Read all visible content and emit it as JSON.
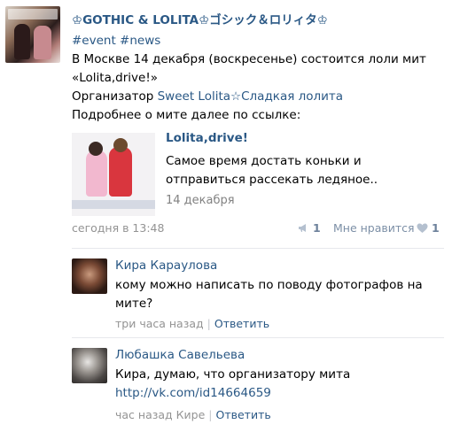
{
  "post": {
    "title": "♔GOTHIC & LOLITA♔ゴシック＆ロリィタ♔",
    "hashtags": "#event #news",
    "text_line1": "В Москве 14 декабря (воскресенье) состоится лоли мит",
    "text_line2": "«Lolita,drive!»",
    "organizer_prefix": "Организатор ",
    "organizer_link": "Sweet Lolita☆Сладкая лолита",
    "text_line4": "Подробнее о мите далее по ссылке:",
    "share": {
      "title": "Lolita,drive!",
      "desc_line1": "Самое время достать коньки и",
      "desc_line2": "отправиться рассекать ледяное..",
      "date": "14 декабря"
    },
    "date": "сегодня в 13:48",
    "share_count": "1",
    "like_label": "Мне нравится",
    "like_count": "1"
  },
  "comments": [
    {
      "name": "Кира Караулова",
      "text_line1": "кому можно написать по поводу фотографов на",
      "text_line2": "мите?",
      "time": "три часа назад",
      "reply_label": "Ответить"
    },
    {
      "name": "Любашка Савельева",
      "text_line1": "Кира, думаю, что организатору мита",
      "link": "http://vk.com/id14664659",
      "time": "час назад Кире",
      "reply_label": "Ответить"
    }
  ],
  "colors": {
    "link": "#2a5885",
    "meta": "#939393",
    "divider": "#e7e8ec"
  }
}
